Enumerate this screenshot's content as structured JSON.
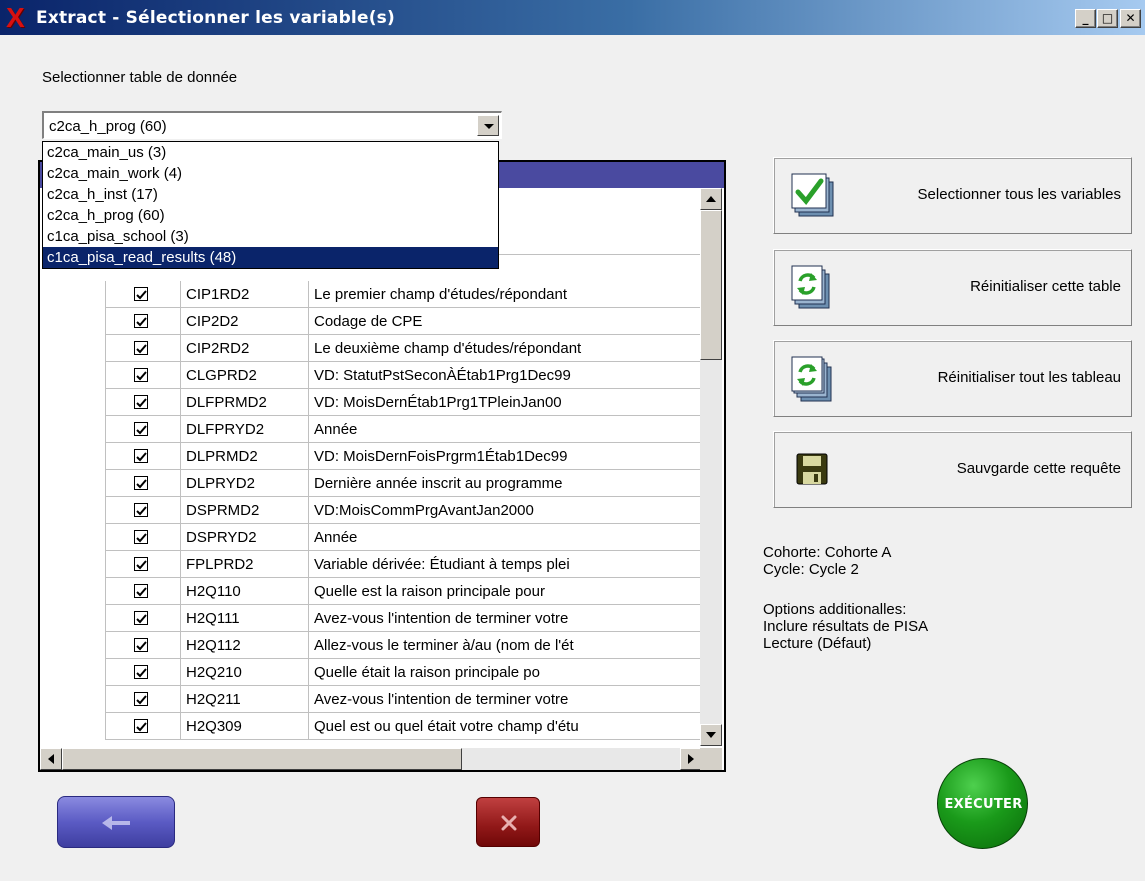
{
  "window": {
    "title": "Extract - Sélectionner les variable(s)",
    "min": "_",
    "max": "□",
    "close": "✕"
  },
  "table_select": {
    "label": "Selectionner table de donnée",
    "value": "c2ca_h_prog (60)",
    "options": [
      "c2ca_main_us (3)",
      "c2ca_main_work (4)",
      "c2ca_h_inst (17)",
      "c2ca_h_prog (60)",
      "c1ca_pisa_school (3)",
      "c1ca_pisa_read_results (48)"
    ],
    "highlighted_index": 5
  },
  "grid": {
    "rows": [
      {
        "name": "CIP1RD2",
        "desc": "Le premier champ d'études/répondant",
        "checked": true
      },
      {
        "name": "CIP2D2",
        "desc": "Codage de CPE",
        "checked": true
      },
      {
        "name": "CIP2RD2",
        "desc": "Le deuxième champ d'études/répondant",
        "checked": true
      },
      {
        "name": "CLGPRD2",
        "desc": "VD: StatutPstSeconÀÉtab1Prg1Dec99",
        "checked": true
      },
      {
        "name": "DLFPRMD2",
        "desc": "VD: MoisDernÉtab1Prg1TPleinJan00",
        "checked": true
      },
      {
        "name": "DLFPRYD2",
        "desc": "Année",
        "checked": true
      },
      {
        "name": "DLPRMD2",
        "desc": "VD:  MoisDernFoisPrgrm1Étab1Dec99",
        "checked": true
      },
      {
        "name": "DLPRYD2",
        "desc": "Dernière année inscrit au programme",
        "checked": true
      },
      {
        "name": "DSPRMD2",
        "desc": "VD:MoisCommPrgAvantJan2000",
        "checked": true
      },
      {
        "name": "DSPRYD2",
        "desc": "Année",
        "checked": true
      },
      {
        "name": "FPLPRD2",
        "desc": "Variable dérivée:  Étudiant à temps plei",
        "checked": true
      },
      {
        "name": "H2Q110",
        "desc": "Quelle est la raison principale pour",
        "checked": true
      },
      {
        "name": "H2Q111",
        "desc": "Avez-vous l'intention de terminer votre",
        "checked": true
      },
      {
        "name": "H2Q112",
        "desc": "Allez-vous le terminer à/au (nom de l'ét",
        "checked": true
      },
      {
        "name": "H2Q210",
        "desc": "Quelle était la raison principale po",
        "checked": true
      },
      {
        "name": "H2Q211",
        "desc": "Avez-vous l'intention de terminer votre",
        "checked": true
      },
      {
        "name": "H2Q309",
        "desc": "Quel est ou quel était votre champ d'étu",
        "checked": true
      }
    ],
    "hidden_row_partial": "Codage de CPE"
  },
  "actions": {
    "select_all": "Selectionner tous les variables",
    "reset_table": "Réinitialiser cette table",
    "reset_all": "Réinitialiser tout les tableau",
    "save_query": "Sauvgarde cette requête"
  },
  "info": {
    "cohort": "Cohorte: Cohorte A",
    "cycle": "Cycle: Cycle 2",
    "options_title": "Options additionalles:",
    "option_1": "Inclure résultats de PISA",
    "option_2": "Lecture (Défaut)"
  },
  "buttons": {
    "execute": "EXÉCUTER"
  },
  "colors": {
    "grid_header": "#4a4aa0",
    "selection": "#0a246a",
    "execute": "#1a9a1a",
    "cancel": "#901818",
    "back": "#5b5bc4"
  }
}
